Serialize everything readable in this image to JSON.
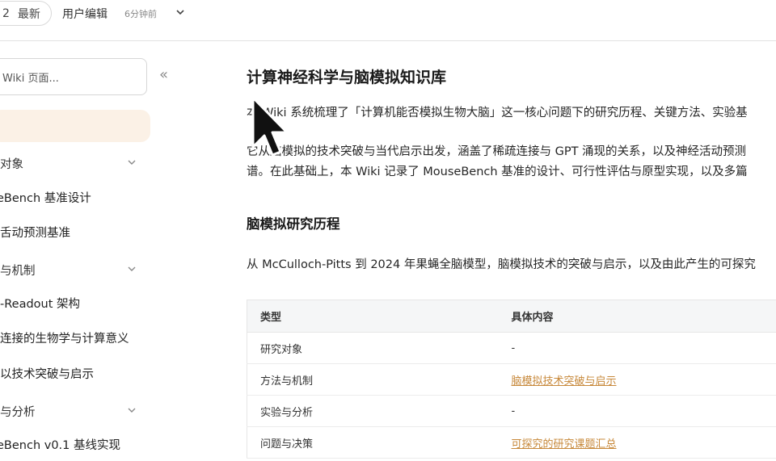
{
  "topbar": {
    "version_number": "2",
    "version_tag": "最新",
    "editor": "用户编辑",
    "time": "6分钟前",
    "dropdown_icon": "chevron-down-icon"
  },
  "sidebar": {
    "search_placeholder": "Wiki 页面...",
    "collapse_icon": "double-chevron-left-icon",
    "items": [
      {
        "label": "对象",
        "type": "group"
      },
      {
        "label": "eBench 基准设计",
        "type": "page"
      },
      {
        "label": "舌动预测基准",
        "type": "page"
      },
      {
        "label": "与机制",
        "type": "group"
      },
      {
        "label": "-Readout 架构",
        "type": "page"
      },
      {
        "label": "连接的生物学与计算意义",
        "type": "page"
      },
      {
        "label": "以技术突破与启示",
        "type": "page"
      },
      {
        "label": "与分析",
        "type": "group"
      },
      {
        "label": "eBench v0.1 基线实现",
        "type": "page"
      }
    ]
  },
  "main": {
    "title": "计算神经科学与脑模拟知识库",
    "para1": "本 Wiki 系统梳理了「计算机能否模拟生物大脑」这一核心问题下的研究历程、关键方法、实验基",
    "para2_line1": "它从脑模拟的技术突破与当代启示出发，涵盖了稀疏连接与 GPT 涌现的关系，以及神经活动预测",
    "para2_line2": "谱。在此基础上，本 Wiki 记录了 MouseBench 基准的设计、可行性评估与原型实现，以及多篇",
    "section_title": "脑模拟研究历程",
    "section_para": "从 McCulloch-Pitts 到 2024 年果蝇全脑模型，脑模拟技术的突破与启示，以及由此产生的可探究",
    "table": {
      "headers": [
        "类型",
        "具体内容"
      ],
      "rows": [
        {
          "type": "研究对象",
          "content": "-",
          "link": false
        },
        {
          "type": "方法与机制",
          "content": "脑模拟技术突破与启示",
          "link": true
        },
        {
          "type": "实验与分析",
          "content": "-",
          "link": false
        },
        {
          "type": "问题与决策",
          "content": "可探究的研究课题汇总",
          "link": true
        }
      ]
    }
  },
  "colors": {
    "accent_link": "#c7883a",
    "active_bg": "#fbf1e6"
  }
}
